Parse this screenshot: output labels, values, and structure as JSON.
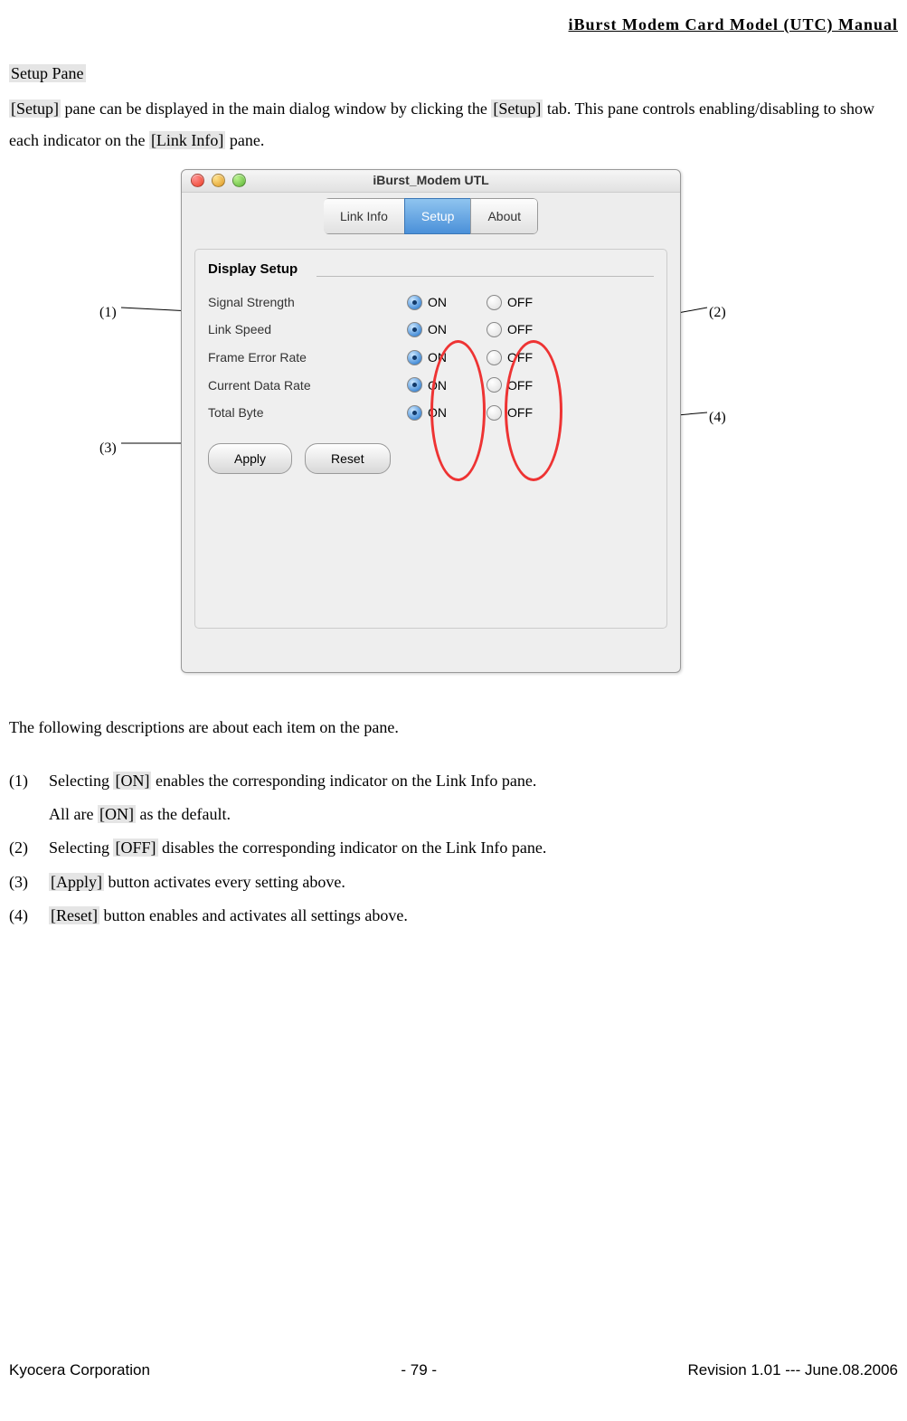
{
  "header": {
    "title": "iBurst  Modem  Card  Model  (UTC)  Manual"
  },
  "section": {
    "heading": "Setup Pane"
  },
  "intro": {
    "p1_a": "[Setup]",
    "p1_b": " pane can be displayed in the main dialog window by clicking the ",
    "p1_c": "[Setup]",
    "p1_d": " tab.    This pane controls enabling/disabling to show each indicator on the ",
    "p1_e": "[Link Info]",
    "p1_f": " pane."
  },
  "callouts": {
    "c1": "(1)",
    "c2": "(2)",
    "c3": "(3)",
    "c4": "(4)"
  },
  "window": {
    "title": "iBurst_Modem UTL",
    "tabs": {
      "link": "Link Info",
      "setup": "Setup",
      "about": "About"
    },
    "group_label": "Display Setup",
    "rows": [
      {
        "label": "Signal Strength",
        "on": "ON",
        "off": "OFF"
      },
      {
        "label": "Link Speed",
        "on": "ON",
        "off": "OFF"
      },
      {
        "label": "Frame Error Rate",
        "on": "ON",
        "off": "OFF"
      },
      {
        "label": "Current Data Rate",
        "on": "ON",
        "off": "OFF"
      },
      {
        "label": "Total Byte",
        "on": "ON",
        "off": "OFF"
      }
    ],
    "buttons": {
      "apply": "Apply",
      "reset": "Reset"
    }
  },
  "desc": {
    "intro": "The following descriptions are about each item on the pane.",
    "items": [
      {
        "num": "(1)",
        "pre": "Selecting ",
        "hl": "[ON]",
        "rest": " enables the corresponding indicator on the Link Info pane.",
        "sub_pre": "All are ",
        "sub_hl": "[ON]",
        "sub_rest": " as the default."
      },
      {
        "num": "(2)",
        "pre": "Selecting ",
        "hl": "[OFF]",
        "rest": " disables the corresponding indicator on the Link Info pane."
      },
      {
        "num": "(3)",
        "pre": "",
        "hl": "[Apply]",
        "rest": " button activates every setting above."
      },
      {
        "num": "(4)",
        "pre": "",
        "hl": "[Reset]",
        "rest": " button enables and activates all settings above."
      }
    ]
  },
  "footer": {
    "left": "Kyocera Corporation",
    "center": "- 79 -",
    "right": "Revision 1.01 --- June.08.2006"
  }
}
